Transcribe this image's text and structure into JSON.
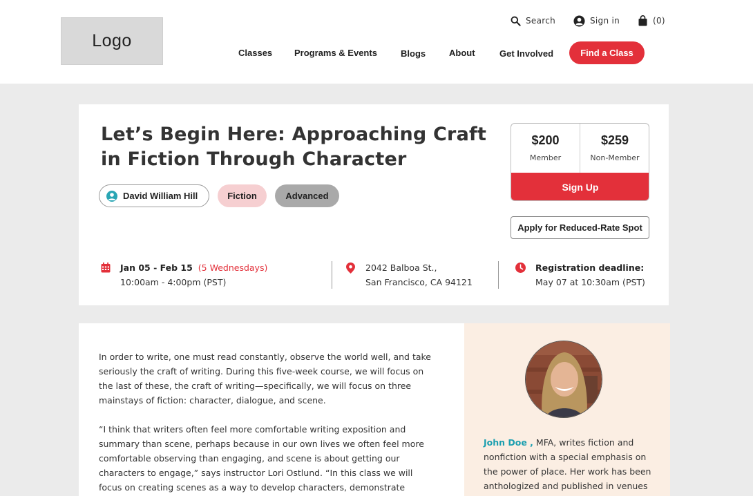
{
  "header": {
    "logo": "Logo",
    "search_label": "Search",
    "signin_label": "Sign in",
    "cart_label": "(0)",
    "nav": [
      "Classes",
      "Programs & Events",
      "Blogs",
      "About",
      "Get Involved"
    ],
    "cta": "Find a Class"
  },
  "course": {
    "title": "Let’s Begin Here: Approaching Craft in Fiction Through Character",
    "instructor": "David William Hill",
    "tags": [
      "Fiction",
      "Advanced"
    ],
    "price_member": "$200",
    "price_member_label": "Member",
    "price_nonmember": "$259",
    "price_nonmember_label": "Non-Member",
    "signup": "Sign Up",
    "reduced": "Apply for Reduced-Rate Spot",
    "dates": "Jan 05 - Feb 15",
    "sessions": "(5 Wednesdays)",
    "time": "10:00am - 4:00pm (PST)",
    "address_line1": "2042 Balboa St.,",
    "address_line2": "San Francisco, CA 94121",
    "deadline_label": "Registration deadline:",
    "deadline": "May 07 at 10:30am (PST)"
  },
  "description": {
    "p1": "In order to write, one must read constantly, observe the world well, and take seriously the craft of writing. During this five-week course, we will focus on the last of these, the craft of writing—specifically, we will focus on three mainstays of fiction: character, dialogue, and scene.",
    "p2": "“I think that writers often feel more comfortable writing exposition and summary than scene, perhaps because in our own lives we often feel more comfortable observing than engaging, and scene is about getting our characters to engage,” says instructor Lori Ostlund. “In this class we will focus on creating scenes as a way to develop characters, demonstrate changes in"
  },
  "bio": {
    "name": "John Doe ,",
    "text": " MFA, writes fiction and nonfiction with a special emphasis on the power of place. Her work has been anthologized and published in venues"
  },
  "colors": {
    "accent": "#e3303a",
    "teal": "#1c9fb0",
    "fiction_chip": "#f6cfd1",
    "advanced_chip": "#a9a9a9",
    "bio_bg": "#fbeee3"
  }
}
